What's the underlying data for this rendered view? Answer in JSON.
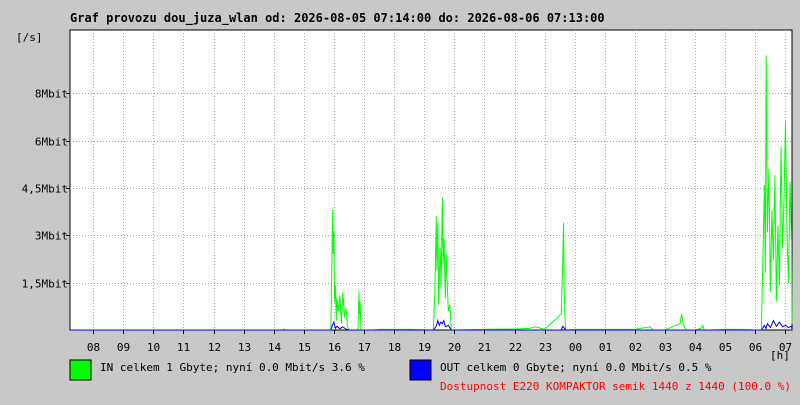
{
  "title": "Graf provozu dou_juza_wlan od: 2026-08-05 07:14:00 do: 2026-08-06 07:13:00",
  "y_unit": "[/s]",
  "x_unit": "[h]",
  "colors": {
    "background": "#c8c8c8",
    "plot_bg": "#ffffff",
    "grid": "#a8a8a8",
    "in_series": "#00ff00",
    "out_series": "#0000ff",
    "legend_text": "#000000",
    "availability": "#ff0000"
  },
  "legend": {
    "in_label": "IN celkem 1 Gbyte; nyní   0.0 Mbit/s 3.6 %",
    "out_label": "OUT celkem 0 Gbyte; nyní   0.0 Mbit/s 0.5 %",
    "availability": "Dostupnost E220 KOMPAKTOR semik 1440 z 1440 (100.0 %)"
  },
  "chart_data": {
    "type": "area",
    "title": "Graf provozu dou_juza_wlan od: 2026-08-05 07:14:00 do: 2026-08-06 07:13:00",
    "xlabel": "[h]",
    "ylabel": "[/s]",
    "x_range_hours": [
      7.233,
      31.217
    ],
    "ylim_mbit": [
      0,
      9.5
    ],
    "grid": true,
    "x_ticks": [
      {
        "label": "08",
        "hour": 8
      },
      {
        "label": "09",
        "hour": 9
      },
      {
        "label": "10",
        "hour": 10
      },
      {
        "label": "11",
        "hour": 11
      },
      {
        "label": "12",
        "hour": 12
      },
      {
        "label": "13",
        "hour": 13
      },
      {
        "label": "14",
        "hour": 14
      },
      {
        "label": "15",
        "hour": 15
      },
      {
        "label": "16",
        "hour": 16
      },
      {
        "label": "17",
        "hour": 17
      },
      {
        "label": "18",
        "hour": 18
      },
      {
        "label": "19",
        "hour": 19
      },
      {
        "label": "20",
        "hour": 20
      },
      {
        "label": "21",
        "hour": 21
      },
      {
        "label": "22",
        "hour": 22
      },
      {
        "label": "23",
        "hour": 23
      },
      {
        "label": "00",
        "hour": 24
      },
      {
        "label": "01",
        "hour": 25
      },
      {
        "label": "02",
        "hour": 26
      },
      {
        "label": "03",
        "hour": 27
      },
      {
        "label": "04",
        "hour": 28
      },
      {
        "label": "05",
        "hour": 29
      },
      {
        "label": "06",
        "hour": 30
      },
      {
        "label": "07",
        "hour": 31
      }
    ],
    "y_ticks": [
      {
        "label": "1,5Mbit",
        "value": 1.5
      },
      {
        "label": "3Mbit",
        "value": 3
      },
      {
        "label": "4,5Mbit",
        "value": 4.5
      },
      {
        "label": "6Mbit",
        "value": 6
      },
      {
        "label": "8Mbit",
        "value": 7.5
      }
    ],
    "series": [
      {
        "name": "IN",
        "color": "#00ff00",
        "hours": [
          7.233,
          14.3,
          14.35,
          14.4,
          15.9,
          15.93,
          15.96,
          15.98,
          16.0,
          16.02,
          16.05,
          16.08,
          16.1,
          16.15,
          16.2,
          16.25,
          16.3,
          16.35,
          16.4,
          16.45,
          16.5,
          16.8,
          16.83,
          16.85,
          16.87,
          16.9,
          17.3,
          17.5,
          18.0,
          18.5,
          19.3,
          19.35,
          19.4,
          19.42,
          19.45,
          19.48,
          19.5,
          19.53,
          19.56,
          19.6,
          19.63,
          19.66,
          19.7,
          19.73,
          19.76,
          19.8,
          19.85,
          19.9,
          20.0,
          21.0,
          21.5,
          22.0,
          22.5,
          22.7,
          23.0,
          23.55,
          23.6,
          23.63,
          23.65,
          23.68,
          23.7,
          24.0,
          25.0,
          26.0,
          26.5,
          26.55,
          26.6,
          27.0,
          27.5,
          27.55,
          27.6,
          27.65,
          27.7,
          28.0,
          28.2,
          28.25,
          28.3,
          28.5,
          29.0,
          29.5,
          30.0,
          30.2,
          30.25,
          30.3,
          30.33,
          30.36,
          30.4,
          30.45,
          30.5,
          30.55,
          30.6,
          30.65,
          30.7,
          30.75,
          30.8,
          30.85,
          30.9,
          30.95,
          31.0,
          31.05,
          31.1,
          31.15,
          31.2,
          31.217
        ],
        "values_mbit": [
          0,
          0,
          0.03,
          0,
          0,
          2.1,
          3.8,
          2.4,
          3.1,
          0.9,
          1.4,
          0.3,
          1.0,
          0.6,
          1.1,
          0.2,
          1.2,
          0.4,
          0.7,
          0.1,
          0,
          0,
          1.2,
          0.5,
          0.9,
          0,
          0,
          0.02,
          0.02,
          0.02,
          0,
          1.1,
          3.6,
          1.9,
          3.4,
          0.8,
          1.7,
          2.6,
          1.3,
          4.2,
          2.1,
          2.9,
          1.0,
          2.4,
          1.6,
          0.6,
          0.8,
          0,
          0,
          0.02,
          0.03,
          0.03,
          0.05,
          0.1,
          0.02,
          0.5,
          2.1,
          3.4,
          1.2,
          0.3,
          0,
          0.02,
          0.02,
          0.02,
          0.1,
          0.05,
          0,
          0,
          0.2,
          0.5,
          0.2,
          0.1,
          0,
          0,
          0.05,
          0.15,
          0,
          0,
          0.02,
          0.02,
          0,
          0,
          2.3,
          4.6,
          1.8,
          8.7,
          3.1,
          5.1,
          1.2,
          3.8,
          2.2,
          4.9,
          0.9,
          3.3,
          1.4,
          5.8,
          2.6,
          4.1,
          6.6,
          3.0,
          1.5,
          4.7,
          2.8,
          0.2
        ]
      },
      {
        "name": "OUT",
        "color": "#0000ff",
        "hours": [
          7.233,
          15.9,
          15.95,
          16.0,
          16.05,
          16.1,
          16.2,
          16.3,
          16.4,
          16.5,
          19.3,
          19.4,
          19.45,
          19.5,
          19.55,
          19.6,
          19.65,
          19.7,
          19.8,
          19.9,
          23.55,
          23.6,
          23.65,
          23.7,
          30.2,
          30.3,
          30.35,
          30.4,
          30.5,
          30.6,
          30.7,
          30.8,
          30.9,
          31.0,
          31.1,
          31.2,
          31.217
        ],
        "values_mbit": [
          0,
          0,
          0.15,
          0.25,
          0.05,
          0.12,
          0.04,
          0.1,
          0.03,
          0,
          0,
          0.12,
          0.3,
          0.15,
          0.25,
          0.2,
          0.3,
          0.1,
          0.15,
          0,
          0,
          0.12,
          0.06,
          0,
          0,
          0.15,
          0.05,
          0.2,
          0.08,
          0.3,
          0.12,
          0.25,
          0.1,
          0.15,
          0.08,
          0.12,
          0
        ]
      }
    ]
  }
}
